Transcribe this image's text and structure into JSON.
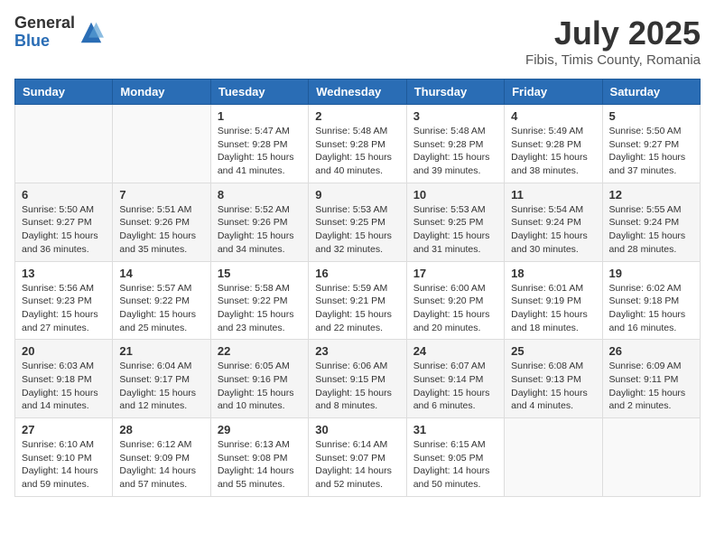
{
  "logo": {
    "general": "General",
    "blue": "Blue"
  },
  "title": "July 2025",
  "location": "Fibis, Timis County, Romania",
  "weekdays": [
    "Sunday",
    "Monday",
    "Tuesday",
    "Wednesday",
    "Thursday",
    "Friday",
    "Saturday"
  ],
  "weeks": [
    [
      {
        "day": "",
        "info": ""
      },
      {
        "day": "",
        "info": ""
      },
      {
        "day": "1",
        "info": "Sunrise: 5:47 AM\nSunset: 9:28 PM\nDaylight: 15 hours and 41 minutes."
      },
      {
        "day": "2",
        "info": "Sunrise: 5:48 AM\nSunset: 9:28 PM\nDaylight: 15 hours and 40 minutes."
      },
      {
        "day": "3",
        "info": "Sunrise: 5:48 AM\nSunset: 9:28 PM\nDaylight: 15 hours and 39 minutes."
      },
      {
        "day": "4",
        "info": "Sunrise: 5:49 AM\nSunset: 9:28 PM\nDaylight: 15 hours and 38 minutes."
      },
      {
        "day": "5",
        "info": "Sunrise: 5:50 AM\nSunset: 9:27 PM\nDaylight: 15 hours and 37 minutes."
      }
    ],
    [
      {
        "day": "6",
        "info": "Sunrise: 5:50 AM\nSunset: 9:27 PM\nDaylight: 15 hours and 36 minutes."
      },
      {
        "day": "7",
        "info": "Sunrise: 5:51 AM\nSunset: 9:26 PM\nDaylight: 15 hours and 35 minutes."
      },
      {
        "day": "8",
        "info": "Sunrise: 5:52 AM\nSunset: 9:26 PM\nDaylight: 15 hours and 34 minutes."
      },
      {
        "day": "9",
        "info": "Sunrise: 5:53 AM\nSunset: 9:25 PM\nDaylight: 15 hours and 32 minutes."
      },
      {
        "day": "10",
        "info": "Sunrise: 5:53 AM\nSunset: 9:25 PM\nDaylight: 15 hours and 31 minutes."
      },
      {
        "day": "11",
        "info": "Sunrise: 5:54 AM\nSunset: 9:24 PM\nDaylight: 15 hours and 30 minutes."
      },
      {
        "day": "12",
        "info": "Sunrise: 5:55 AM\nSunset: 9:24 PM\nDaylight: 15 hours and 28 minutes."
      }
    ],
    [
      {
        "day": "13",
        "info": "Sunrise: 5:56 AM\nSunset: 9:23 PM\nDaylight: 15 hours and 27 minutes."
      },
      {
        "day": "14",
        "info": "Sunrise: 5:57 AM\nSunset: 9:22 PM\nDaylight: 15 hours and 25 minutes."
      },
      {
        "day": "15",
        "info": "Sunrise: 5:58 AM\nSunset: 9:22 PM\nDaylight: 15 hours and 23 minutes."
      },
      {
        "day": "16",
        "info": "Sunrise: 5:59 AM\nSunset: 9:21 PM\nDaylight: 15 hours and 22 minutes."
      },
      {
        "day": "17",
        "info": "Sunrise: 6:00 AM\nSunset: 9:20 PM\nDaylight: 15 hours and 20 minutes."
      },
      {
        "day": "18",
        "info": "Sunrise: 6:01 AM\nSunset: 9:19 PM\nDaylight: 15 hours and 18 minutes."
      },
      {
        "day": "19",
        "info": "Sunrise: 6:02 AM\nSunset: 9:18 PM\nDaylight: 15 hours and 16 minutes."
      }
    ],
    [
      {
        "day": "20",
        "info": "Sunrise: 6:03 AM\nSunset: 9:18 PM\nDaylight: 15 hours and 14 minutes."
      },
      {
        "day": "21",
        "info": "Sunrise: 6:04 AM\nSunset: 9:17 PM\nDaylight: 15 hours and 12 minutes."
      },
      {
        "day": "22",
        "info": "Sunrise: 6:05 AM\nSunset: 9:16 PM\nDaylight: 15 hours and 10 minutes."
      },
      {
        "day": "23",
        "info": "Sunrise: 6:06 AM\nSunset: 9:15 PM\nDaylight: 15 hours and 8 minutes."
      },
      {
        "day": "24",
        "info": "Sunrise: 6:07 AM\nSunset: 9:14 PM\nDaylight: 15 hours and 6 minutes."
      },
      {
        "day": "25",
        "info": "Sunrise: 6:08 AM\nSunset: 9:13 PM\nDaylight: 15 hours and 4 minutes."
      },
      {
        "day": "26",
        "info": "Sunrise: 6:09 AM\nSunset: 9:11 PM\nDaylight: 15 hours and 2 minutes."
      }
    ],
    [
      {
        "day": "27",
        "info": "Sunrise: 6:10 AM\nSunset: 9:10 PM\nDaylight: 14 hours and 59 minutes."
      },
      {
        "day": "28",
        "info": "Sunrise: 6:12 AM\nSunset: 9:09 PM\nDaylight: 14 hours and 57 minutes."
      },
      {
        "day": "29",
        "info": "Sunrise: 6:13 AM\nSunset: 9:08 PM\nDaylight: 14 hours and 55 minutes."
      },
      {
        "day": "30",
        "info": "Sunrise: 6:14 AM\nSunset: 9:07 PM\nDaylight: 14 hours and 52 minutes."
      },
      {
        "day": "31",
        "info": "Sunrise: 6:15 AM\nSunset: 9:05 PM\nDaylight: 14 hours and 50 minutes."
      },
      {
        "day": "",
        "info": ""
      },
      {
        "day": "",
        "info": ""
      }
    ]
  ]
}
